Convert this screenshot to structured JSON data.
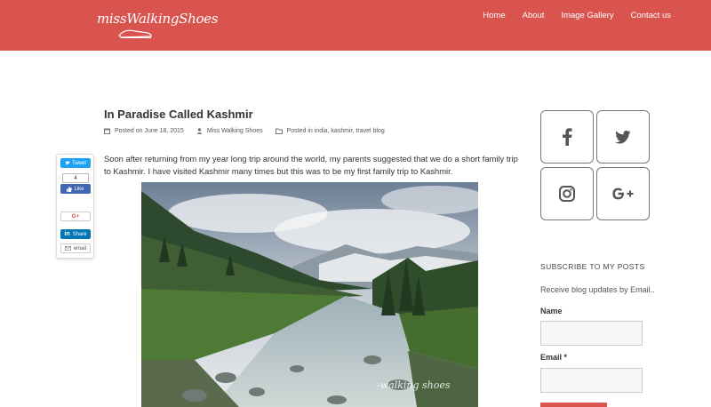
{
  "header": {
    "logo_text": "missWalkingShoes",
    "nav": [
      "Home",
      "About",
      "Image Gallery",
      "Contact us"
    ]
  },
  "post": {
    "title": "In Paradise Called Kashmir",
    "posted_on": "Posted on June 18, 2015",
    "author": "Miss Walking Shoes",
    "posted_in": "Posted in india, kashmir, travel blog",
    "paragraph": "Soon after returning from my year long trip around the world, my parents suggested that we do a short family trip to Kashmir. I have visited Kashmir many times but this was to be my first family trip to Kashmir.",
    "photo_watermark": "-walking shoes"
  },
  "share": {
    "tweet": "Tweet",
    "fb_count": "4",
    "fb_like": "Like",
    "gplus": "G+",
    "linkedin": "Share",
    "email": "email"
  },
  "sidebar": {
    "social_icons": [
      "facebook-icon",
      "twitter-icon",
      "instagram-icon",
      "google-plus-icon"
    ],
    "subscribe_title": "SUBSCRIBE TO MY POSTS",
    "subscribe_desc": "Receive blog updates by Email..",
    "name_label": "Name",
    "email_label": "Email *"
  },
  "colors": {
    "brand": "#d9534f",
    "text": "#333333"
  }
}
